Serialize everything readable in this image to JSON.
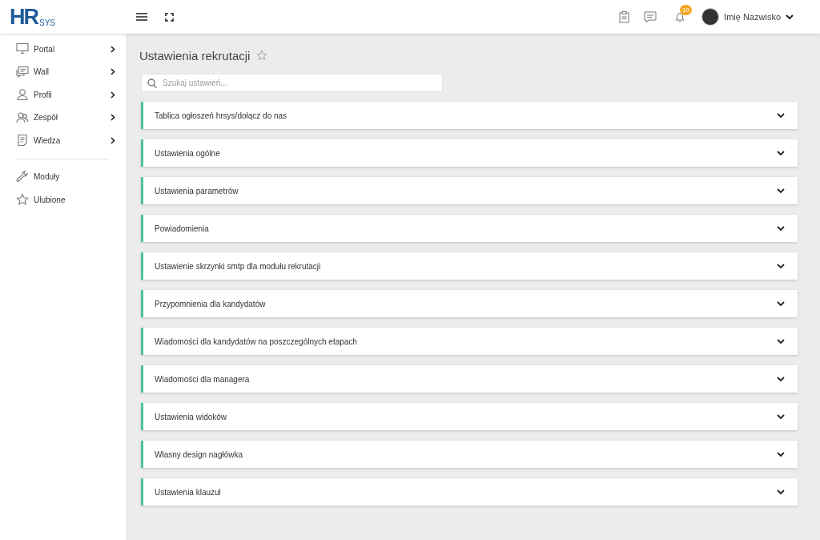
{
  "logo": {
    "mark": "HR",
    "suffix": "SYS"
  },
  "topbar": {
    "notifications": "10",
    "user": "Imię Nazwisko"
  },
  "sidebar": {
    "items": [
      {
        "label": "Portal",
        "expandable": true
      },
      {
        "label": "Wall",
        "expandable": true
      },
      {
        "label": "Profil",
        "expandable": true
      },
      {
        "label": "Zespół",
        "expandable": true
      },
      {
        "label": "Wiedza",
        "expandable": true
      }
    ],
    "bottom_items": [
      {
        "label": "Moduły"
      },
      {
        "label": "Ulubione"
      }
    ]
  },
  "page": {
    "title": "Ustawienia rekrutacji",
    "search": {
      "placeholder": "Szukaj ustawień..."
    },
    "sections": [
      {
        "label": "Tablica ogłoszeń hrsys/dołącz do nas",
        "expanded": false
      },
      {
        "label": "Ustawienia ogólne",
        "expanded": false
      },
      {
        "label": "Ustawienia parametrów",
        "expanded": false
      },
      {
        "label": "Powiadomienia",
        "expanded": false
      },
      {
        "label": "Ustawienie skrzynki smtp dla modułu rekrutacji",
        "expanded": false
      },
      {
        "label": "Przypomnienia dla kandydatów",
        "expanded": false
      },
      {
        "label": "Wiadomości dla kandydatów na poszczególnych etapach",
        "expanded": false
      },
      {
        "label": "Wiadomości dla managera",
        "expanded": false
      },
      {
        "label": "Ustawienia widoków",
        "expanded": false
      },
      {
        "label": "Własny design nagłówka",
        "expanded": false
      },
      {
        "label": "Ustawienia klauzul",
        "expanded": false
      }
    ]
  }
}
